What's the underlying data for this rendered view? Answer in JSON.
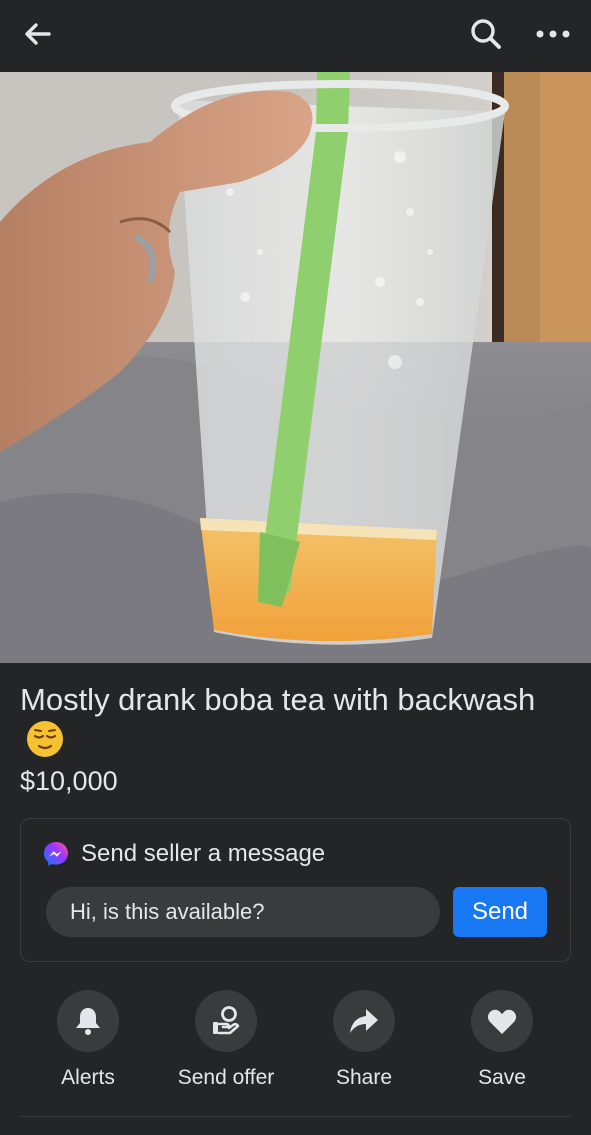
{
  "topbar": {
    "back_icon": "left-arrow-icon",
    "search_icon": "search-icon",
    "more_icon": "more-options-icon"
  },
  "listing": {
    "title": "Mostly drank boba tea with backwash",
    "title_emoji": "relieved-face-emoji",
    "price": "$10,000"
  },
  "message": {
    "heading": "Send seller a message",
    "input_value": "Hi, is this available?",
    "send_label": "Send",
    "send_color": "#1877f2"
  },
  "actions": [
    {
      "label": "Alerts",
      "icon": "bell-icon"
    },
    {
      "label": "Send offer",
      "icon": "offer-icon"
    },
    {
      "label": "Share",
      "icon": "share-arrow-icon"
    },
    {
      "label": "Save",
      "icon": "heart-icon"
    }
  ]
}
